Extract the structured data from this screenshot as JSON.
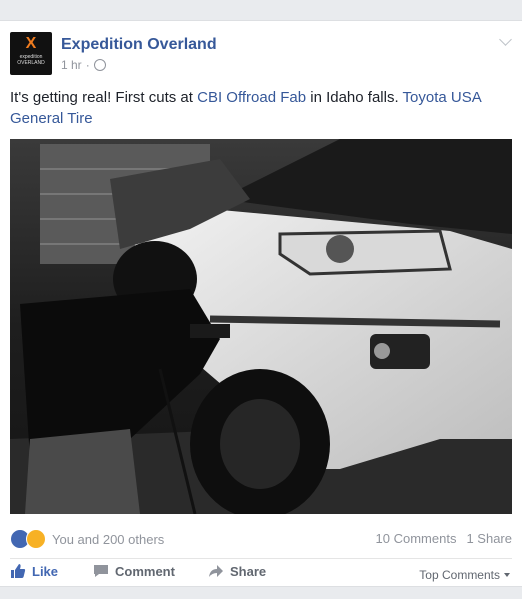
{
  "post": {
    "page_name": "Expedition Overland",
    "time": "1 hr",
    "separator": "·",
    "text_1": "It's getting real! First cuts at ",
    "link_1": "CBI Offroad Fab",
    "text_2": " in Idaho falls. ",
    "link_2": "Toyota USA",
    "link_3": "General Tire",
    "logo": {
      "x": "X",
      "line1": "expedition",
      "line2": "OVERLAND"
    }
  },
  "reactions": {
    "summary": "You and 200 others",
    "comments": "10 Comments",
    "shares": "1 Share"
  },
  "actions": {
    "like": "Like",
    "comment": "Comment",
    "share": "Share",
    "top_comments": "Top Comments"
  },
  "colors": {
    "link": "#365899",
    "like_blue": "#4267b2",
    "wow_yellow": "#f7b125",
    "accent_orange": "#f07c1f"
  }
}
